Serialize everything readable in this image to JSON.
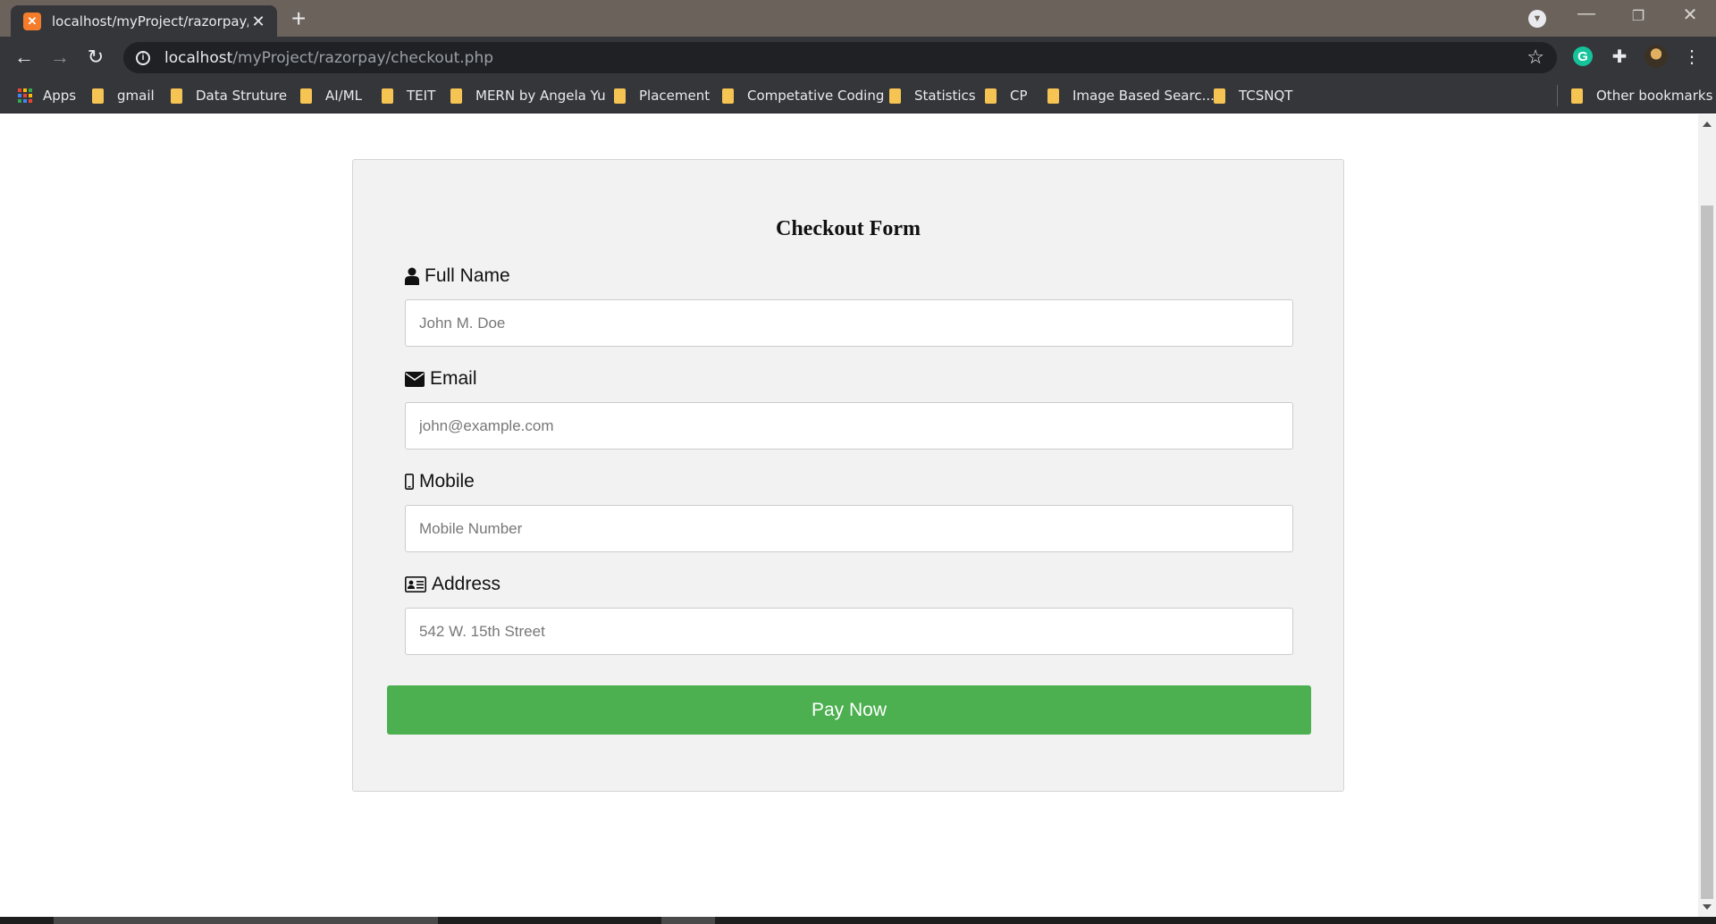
{
  "browser": {
    "tab_title": "localhost/myProject/razorpay/ch",
    "favicon_glyph": "✕",
    "url_host": "localhost",
    "url_path": "/myProject/razorpay/checkout.php",
    "bookmarks": [
      "Apps",
      "gmail",
      "Data Struture",
      "AI/ML",
      "TEIT",
      "MERN by Angela Yu",
      "Placement",
      "Competative Coding",
      "Statistics",
      "CP",
      "Image Based Searc...",
      "TCSNQT"
    ],
    "other_bookmarks": "Other bookmarks",
    "extension_g": "G"
  },
  "form": {
    "title": "Checkout Form",
    "full_name": {
      "label": "Full Name",
      "placeholder": "John M. Doe",
      "icon": "user-icon"
    },
    "email": {
      "label": "Email",
      "placeholder": "john@example.com",
      "icon": "envelope-icon"
    },
    "mobile": {
      "label": "Mobile",
      "placeholder": "Mobile Number",
      "icon": "mobile-phone-icon"
    },
    "address": {
      "label": "Address",
      "placeholder": "542 W. 15th Street",
      "icon": "address-card-icon"
    },
    "submit_label": "Pay Now",
    "submit_color": "#4caf50"
  }
}
